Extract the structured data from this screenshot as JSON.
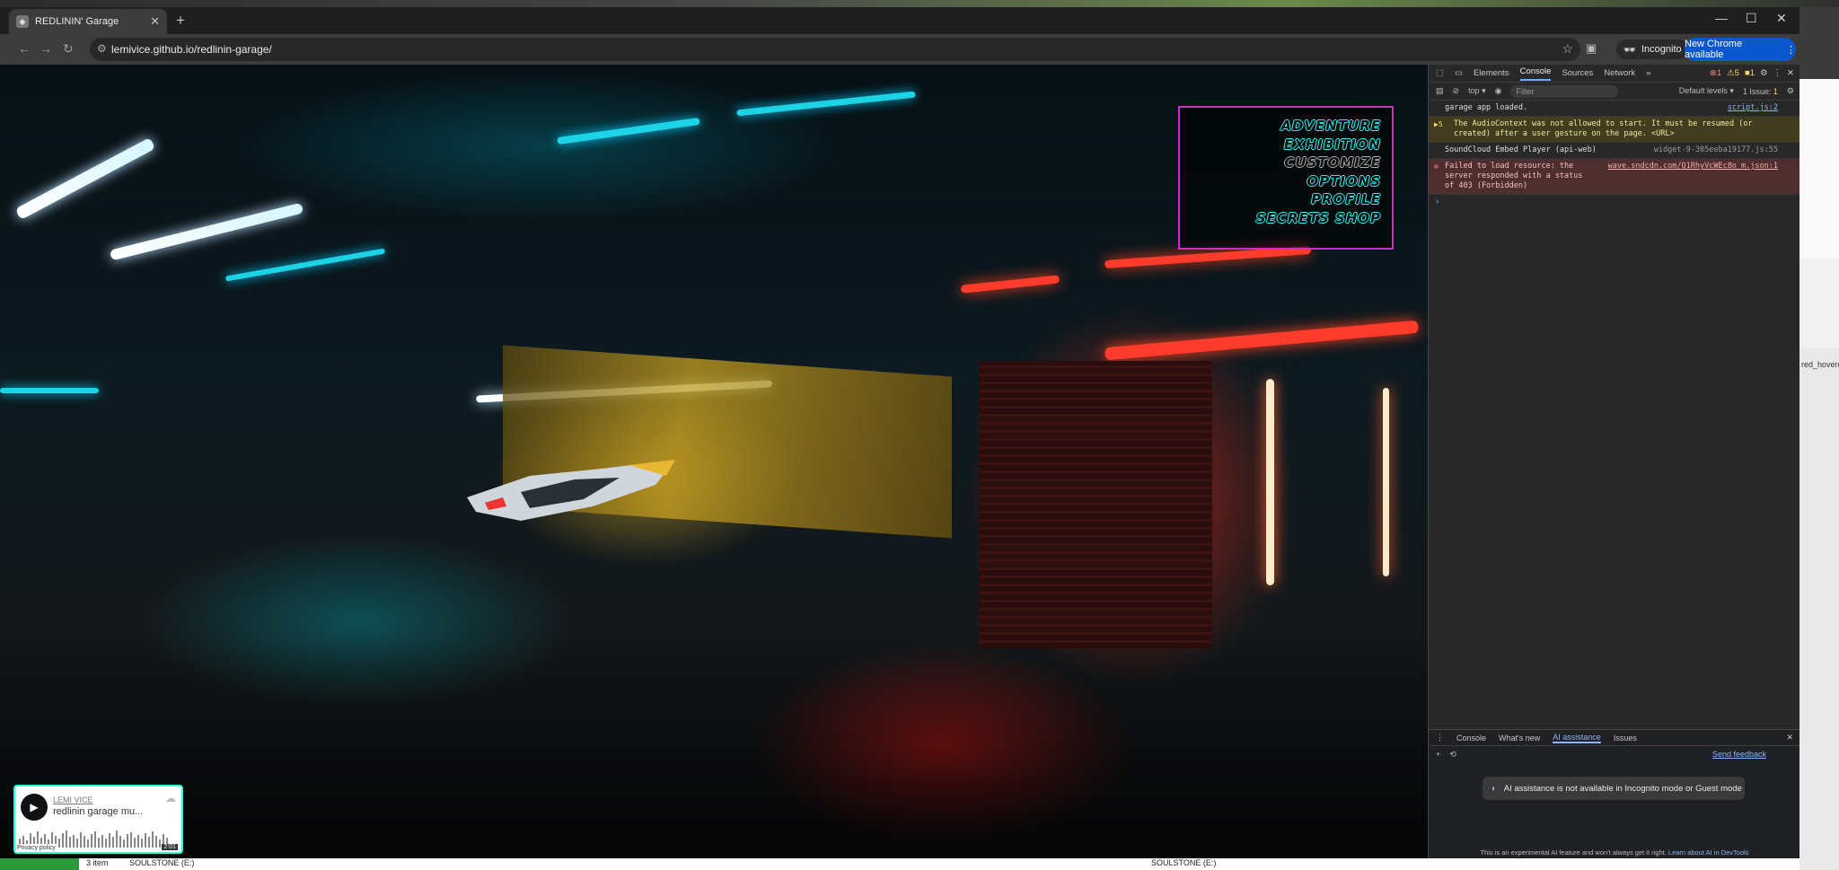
{
  "browser": {
    "tab_title": "REDLININ' Garage",
    "url": "lemivice.github.io/redlinin-garage/",
    "incognito_label": "Incognito",
    "new_chrome_label": "New Chrome available"
  },
  "game_menu": {
    "items": [
      "ADVENTURE",
      "EXHIBITION",
      "CUSTOMIZE",
      "OPTIONS",
      "PROFILE",
      "SECRETS SHOP"
    ]
  },
  "soundcloud": {
    "artist": "LEMI VICE",
    "track": "redlinin garage mu...",
    "privacy": "Privacy policy",
    "duration": "2:01"
  },
  "devtools": {
    "tabs": [
      "Elements",
      "Console",
      "Sources",
      "Network"
    ],
    "active_tab": "Console",
    "error_count": "1",
    "warning_count": "5",
    "issue_badge": "1",
    "context": "top",
    "filter_placeholder": "Filter",
    "levels": "Default levels",
    "issues_label": "1 Issue:",
    "issues_count": "1",
    "logs": [
      {
        "text": "garage app loaded.",
        "source": "script.js:2"
      },
      {
        "text": "The AudioContext was not allowed to start. It must be resumed (or created) after a user gesture on the page. <URL>",
        "count": "5"
      },
      {
        "text": "SoundCloud Embed Player (api-web)",
        "source": "widget-9-305eeba19177.js:55"
      },
      {
        "text": "Failed to load resource: the server responded with a status of 403 (Forbidden)",
        "source": "wave.sndcdn.com/Q1RhyVcWEc8o_m.json:1"
      }
    ],
    "drawer_tabs": [
      "Console",
      "What's new",
      "AI assistance",
      "Issues"
    ],
    "drawer_active": "AI assistance",
    "send_feedback": "Send feedback",
    "ai_notice": "AI assistance is not available in Incognito mode or Guest mode",
    "ai_footer": "This is an experimental AI feature and won't always get it right.",
    "ai_footer_link": "Learn about AI in DevTools"
  },
  "side_window": {
    "fragment": "red_hoverca"
  },
  "taskbar": {
    "items_label": "3 item",
    "drive_left": "SOULSTONE (E:)",
    "drive_right": "SOULSTONE (E:)"
  },
  "colors": {
    "menu_border": "#d02ad0",
    "menu_text_glow": "#22ffff",
    "widget_border": "#22ffdd",
    "chrome_accent": "#0b57d0"
  }
}
